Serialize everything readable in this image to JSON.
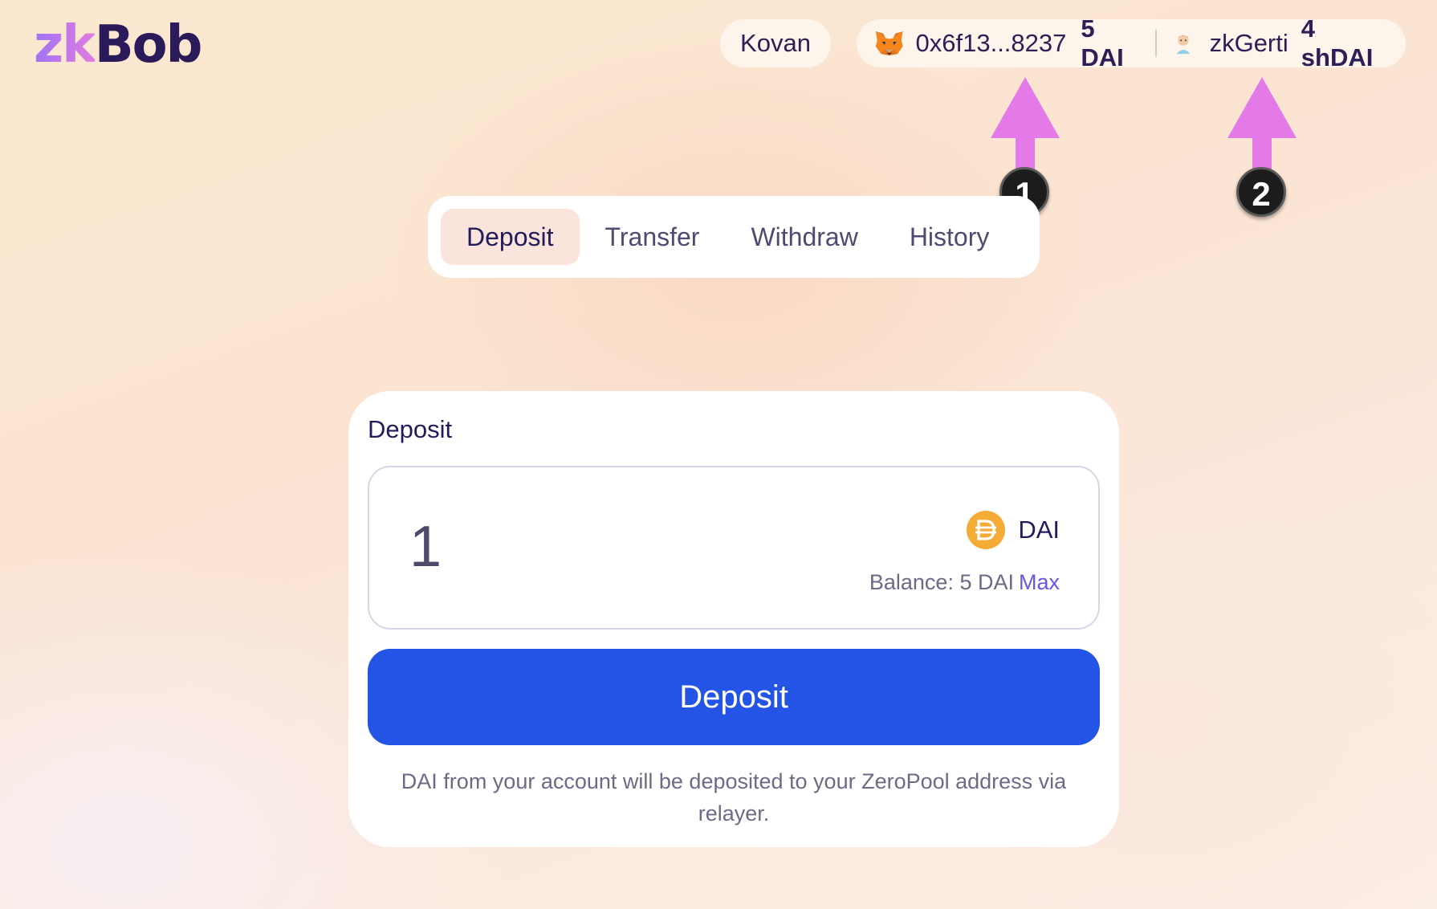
{
  "app": {
    "logo_part1": "zk",
    "logo_part2": "Bob"
  },
  "header": {
    "network": "Kovan",
    "wallet_address": "0x6f13...8237",
    "wallet_balance": "5 DAI",
    "zk_account_name": "zkGerti",
    "zk_balance": "4 shDAI"
  },
  "annotations": {
    "badge1": "1",
    "badge2": "2",
    "arrow_color": "#e47ae8"
  },
  "tabs": [
    {
      "label": "Deposit",
      "active": true
    },
    {
      "label": "Transfer",
      "active": false
    },
    {
      "label": "Withdraw",
      "active": false
    },
    {
      "label": "History",
      "active": false
    }
  ],
  "deposit_card": {
    "title": "Deposit",
    "amount": "1",
    "token": "DAI",
    "balance_label": "Balance: 5 DAI",
    "max_label": "Max",
    "button_label": "Deposit",
    "note": "DAI from your account will be deposited to your ZeroPool address via relayer."
  },
  "colors": {
    "primary_button": "#2354e6",
    "max_link": "#6a55e6",
    "active_tab_bg": "#fbe4dc",
    "dai_icon": "#f5ac37"
  }
}
